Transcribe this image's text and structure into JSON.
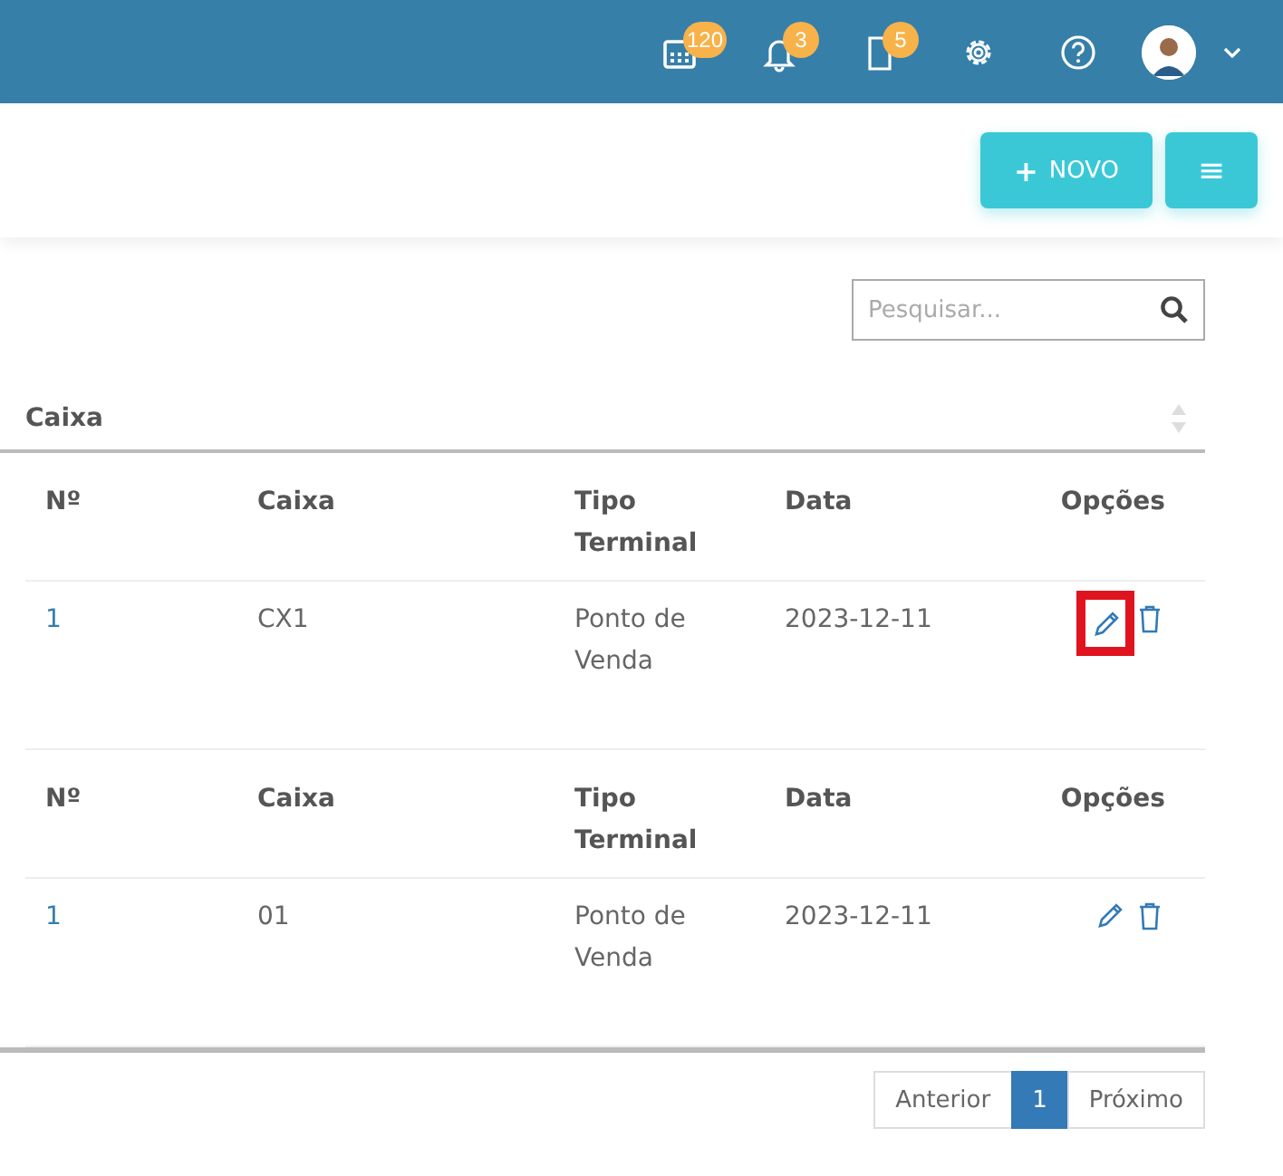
{
  "topbar": {
    "badges": [
      {
        "kind": "calendar",
        "count": "120"
      },
      {
        "kind": "bell",
        "count": "3"
      },
      {
        "kind": "document",
        "count": "5"
      }
    ]
  },
  "toolbar": {
    "new_button": {
      "icon": "+",
      "label": "NOVO"
    },
    "menu_button": {
      "icon": "≡"
    }
  },
  "search": {
    "placeholder": "Pesquisar..."
  },
  "table": {
    "title": "Caixa",
    "groups": [
      {
        "columns": [
          "Nº",
          "Caixa",
          "Tipo Terminal",
          "Data",
          "Opções"
        ],
        "rows": [
          {
            "cells": [
              "1",
              "CX1",
              "Ponto de Venda",
              "2023-12-11"
            ],
            "edit_highlighted": true
          }
        ]
      },
      {
        "columns": [
          "Nº",
          "Caixa",
          "Tipo Terminal",
          "Data",
          "Opções"
        ],
        "rows": [
          {
            "cells": [
              "1",
              "01",
              "Ponto de Venda",
              "2023-12-11"
            ],
            "edit_highlighted": false
          }
        ]
      }
    ]
  },
  "pagination": [
    {
      "label": "Anterior",
      "selected": false
    },
    {
      "label": "1",
      "selected": true
    },
    {
      "label": "Próximo",
      "selected": false
    }
  ]
}
